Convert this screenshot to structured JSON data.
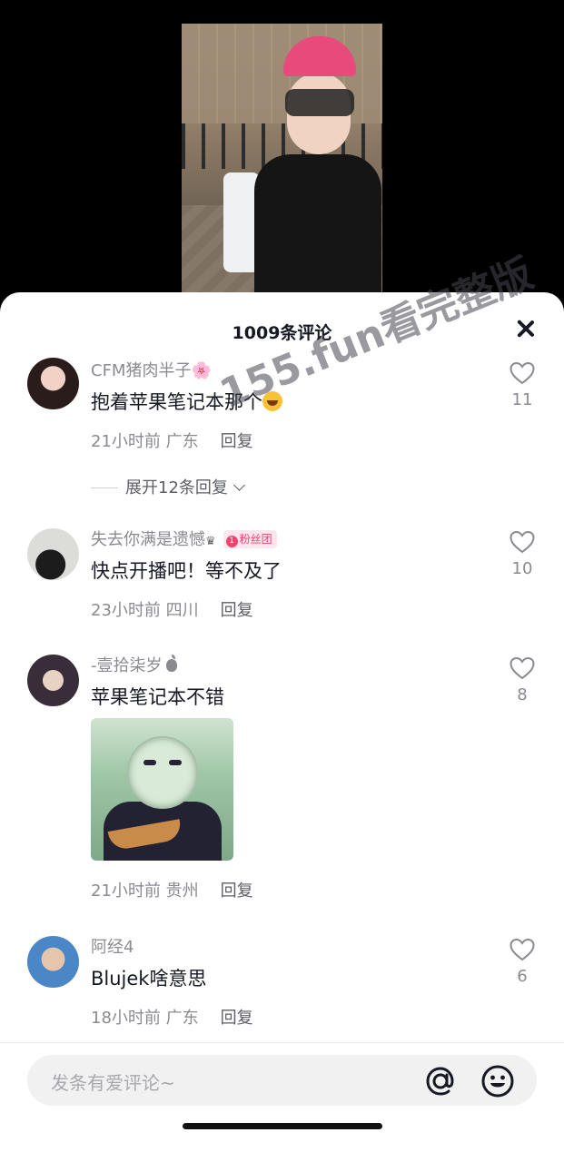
{
  "header": {
    "comment_count": "1009条评论"
  },
  "comments": [
    {
      "username": "CFM猪肉半子",
      "username_emoji": "🌸",
      "text": "抱着苹果笔记本那个",
      "time_location": "21小时前 广东",
      "reply_label": "回复",
      "likes": "11",
      "expand_label": "展开12条回复"
    },
    {
      "username": "失去你满是遗憾",
      "badge_icon": "♛",
      "fan_badge": "粉丝团",
      "fan_badge_level": "1",
      "text": "快点开播吧！等不及了",
      "time_location": "23小时前 四川",
      "reply_label": "回复",
      "likes": "10"
    },
    {
      "username": "-壹拾柒岁",
      "text": "苹果笔记本不错",
      "time_location": "21小时前 贵州",
      "reply_label": "回复",
      "likes": "8"
    },
    {
      "username": "阿经4",
      "text": "Blujek啥意思",
      "time_location": "18小时前 广东",
      "reply_label": "回复",
      "likes": "6"
    }
  ],
  "input": {
    "placeholder": "发条有爱评论~"
  },
  "watermark": "155.fun看完整版",
  "icons": {
    "close": "close-icon",
    "like": "heart-outline-icon",
    "mention": "at-icon",
    "emoji": "emoji-face-icon",
    "apple": "apple-logo-icon"
  },
  "colors": {
    "text_primary": "#161823",
    "text_secondary": "#8a8b91",
    "fan_badge": "#f0436e"
  }
}
